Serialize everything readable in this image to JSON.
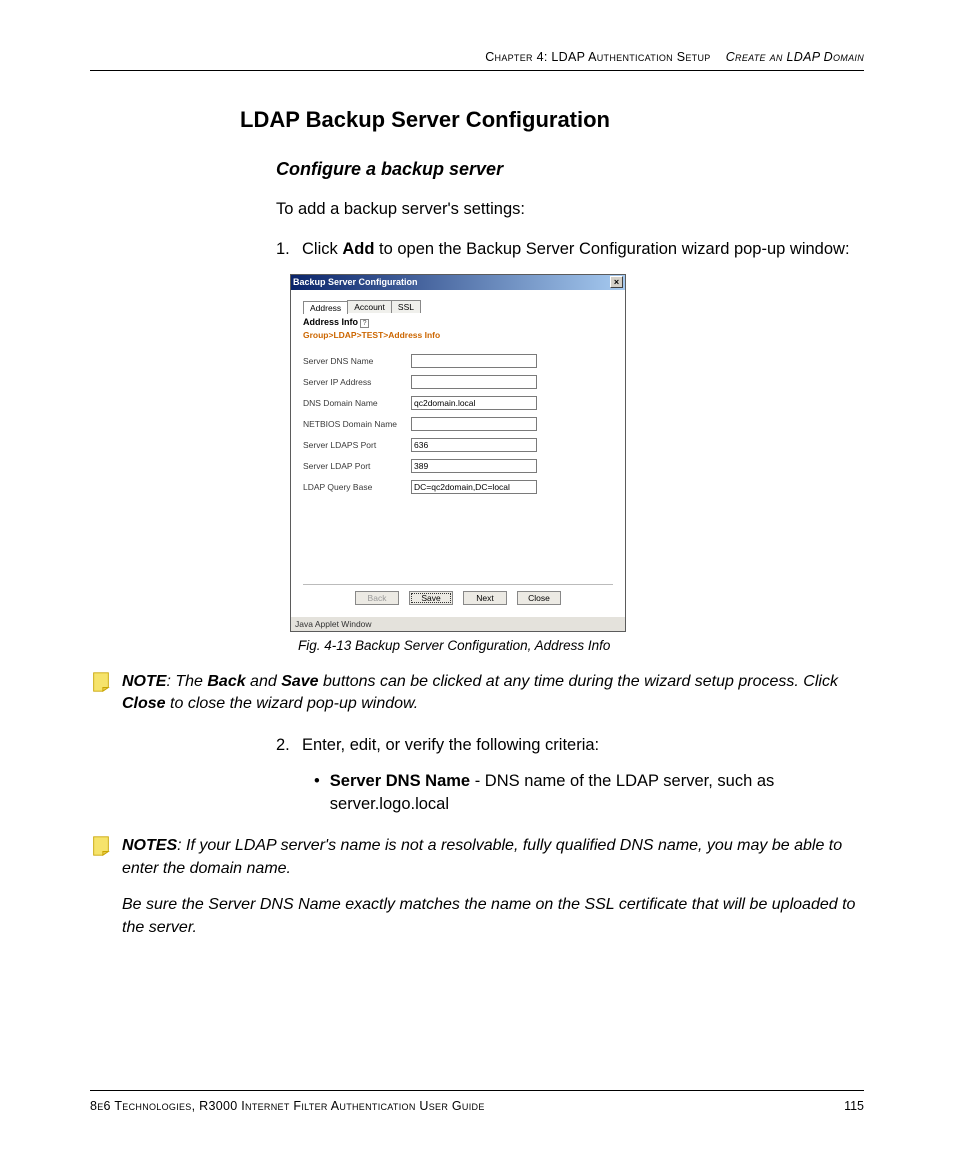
{
  "header": {
    "chapter": "Chapter 4: LDAP Authentication Setup",
    "section": "Create an LDAP Domain"
  },
  "main": {
    "h1": "LDAP Backup Server Configuration",
    "h2": "Configure a backup server",
    "intro": "To add a backup server's settings:",
    "step1_pre": "Click ",
    "step1_bold": "Add",
    "step1_post": " to open the Backup Server Configuration wizard pop-up window:",
    "step2": "Enter, edit, or verify the following criteria:",
    "bullet_bold": "Server DNS Name",
    "bullet_rest": " - DNS name of the LDAP server, such as server.logo.local"
  },
  "dialog": {
    "title": "Backup Server Configuration",
    "tabs": [
      "Address",
      "Account",
      "SSL"
    ],
    "section_label": "Address Info",
    "breadcrumb": "Group>LDAP>TEST>Address Info",
    "fields": [
      {
        "label": "Server DNS Name",
        "value": ""
      },
      {
        "label": "Server IP Address",
        "value": ""
      },
      {
        "label": "DNS Domain Name",
        "value": "qc2domain.local"
      },
      {
        "label": "NETBIOS Domain Name",
        "value": ""
      },
      {
        "label": "Server LDAPS Port",
        "value": "636"
      },
      {
        "label": "Server LDAP Port",
        "value": "389"
      },
      {
        "label": "LDAP Query Base",
        "value": "DC=qc2domain,DC=local"
      }
    ],
    "buttons": {
      "back": "Back",
      "save": "Save",
      "next": "Next",
      "close": "Close"
    },
    "applet": "Java Applet Window"
  },
  "caption": "Fig. 4-13  Backup Server Configuration, Address Info",
  "note1": {
    "lead": "NOTE",
    "t1": ": The ",
    "b1": "Back",
    "t2": " and ",
    "b2": "Save",
    "t3": " buttons can be clicked at any time during the wizard setup process. Click ",
    "b3": "Close",
    "t4": " to close the wizard pop-up window."
  },
  "note2": {
    "lead": "NOTES",
    "body1": ": If your LDAP server's name is not a resolvable, fully qualified DNS name, you may be able to enter the domain name.",
    "body2": "Be sure the Server DNS Name exactly matches the name on the SSL certificate that will be uploaded to the server."
  },
  "footer": {
    "left": "8e6 Technologies, R3000 Internet Filter Authentication User Guide",
    "page": "115"
  }
}
